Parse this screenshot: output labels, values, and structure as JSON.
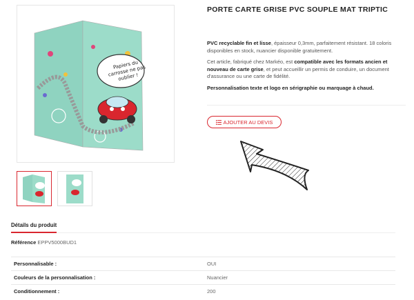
{
  "product": {
    "title": "PORTE CARTE GRISE PVC SOUPLE MAT TRIPTIC",
    "image_text": "Papiers du carrosse ne pas oublier !",
    "desc1": {
      "b": "PVC recyclable fin et lisse",
      "rest": ", épaisseur 0,3mm, parfaitement résistant. 18 coloris disponibles en stock, nuancier disponible gratuitement."
    },
    "desc2": {
      "a": "Cet article, fabriqué chez Markéo, est ",
      "b": "compatible avec les formats ancien et nouveau de carte grise",
      "c": ", et peut accueillir un permis de conduire, un document d'assurance ou une carte de fidélité."
    },
    "desc3": "Personnalisation texte et logo en sérigraphie ou marquage à chaud.",
    "devis_label": "AJOUTER AU DEVIS"
  },
  "tabs": {
    "details": "Détails du produit"
  },
  "reference": {
    "label": "Référence",
    "value": "EPPV5000BUD1"
  },
  "specs": [
    {
      "key": "Personnalisable :",
      "value": "OUI"
    },
    {
      "key": "Couleurs de la personnalisation :",
      "value": "Nuancier"
    },
    {
      "key": "Conditionnement :",
      "value": "200"
    }
  ],
  "colors": {
    "accent": "#d9262e",
    "mint": "#8fd3c0"
  }
}
